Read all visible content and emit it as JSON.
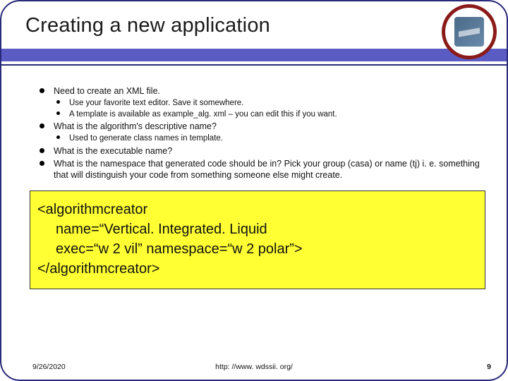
{
  "title": "Creating a new application",
  "logo": {
    "name": "nssl-logo"
  },
  "bullets": [
    {
      "text": "Need to create an XML file.",
      "sub": [
        "Use your favorite text editor. Save it somewhere.",
        "A template is available as example_alg. xml – you can edit this if you want."
      ]
    },
    {
      "text": "What is the algorithm's descriptive name?",
      "sub": [
        "Used to generate class names in template."
      ]
    },
    {
      "text": "What is the executable name?",
      "sub": []
    },
    {
      "text": "What is the namespace that generated code should be in? Pick your group (casa) or name (tj) i. e. something that will distinguish your code from something someone else might create.",
      "sub": []
    }
  ],
  "code": {
    "l1": "<algorithmcreator",
    "l2": "name=“Vertical. Integrated. Liquid",
    "l3": "exec=“w 2 vil” namespace=“w 2 polar”>",
    "l4": "</algorithmcreator>"
  },
  "footer": {
    "date": "9/26/2020",
    "url": "http: //www. wdssii. org/",
    "page": "9"
  }
}
